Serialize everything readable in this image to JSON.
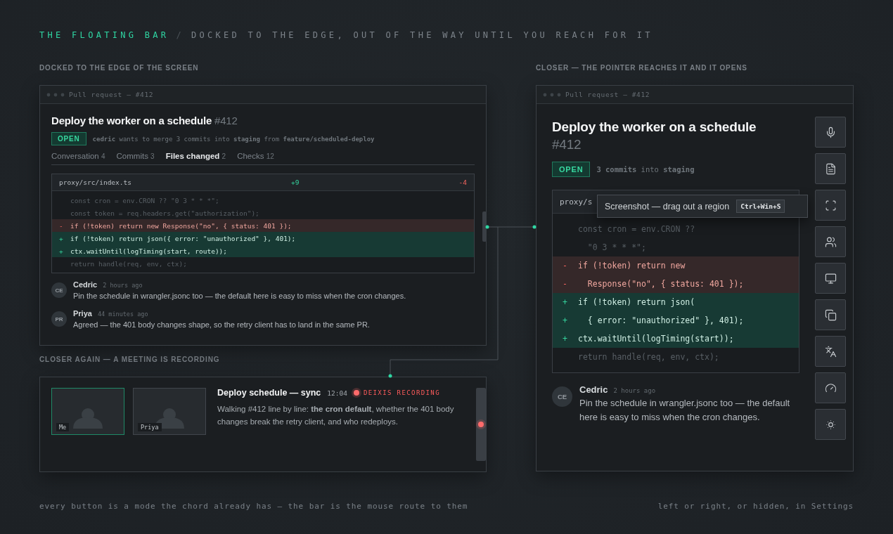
{
  "header": {
    "title": "THE FLOATING BAR",
    "separator": "/",
    "subtitle": "DOCKED TO THE EDGE, OUT OF THE WAY UNTIL YOU REACH FOR IT"
  },
  "docked": {
    "label": "DOCKED TO THE EDGE OF THE SCREEN",
    "window": {
      "titlebar": "Pull request – #412",
      "title": "Deploy the worker on a schedule",
      "number": "#412",
      "status": "OPEN",
      "meta": "**cedric** wants to merge 3 commits into **staging** from **feature/scheduled-deploy**",
      "tabs": [
        {
          "label": "Conversation",
          "count": "4",
          "selected": false
        },
        {
          "label": "Commits",
          "count": "3",
          "selected": false
        },
        {
          "label": "Files changed",
          "count": "2",
          "selected": true
        },
        {
          "label": "Checks",
          "count": "12",
          "selected": false
        }
      ],
      "diff": {
        "file": "proxy/src/index.ts",
        "additions": "+9",
        "deletions": "-4",
        "lines": [
          {
            "kind": "context",
            "code": "const cron = env.CRON ?? \"0 3 * * *\";"
          },
          {
            "kind": "context",
            "code": "const token = req.headers.get(\"authorization\");"
          },
          {
            "kind": "del",
            "sign": "-",
            "code": "if (!token) return new Response(\"no\", { status: 401 });"
          },
          {
            "kind": "add",
            "sign": "+",
            "code": "if (!token) return json({ error: \"unauthorized\" }, 401);"
          },
          {
            "kind": "add",
            "sign": "+",
            "code": "ctx.waitUntil(logTiming(start, route));"
          },
          {
            "kind": "context",
            "code": "return handle(req, env, ctx);"
          }
        ]
      },
      "comments": [
        {
          "initials": "CE",
          "author": "Cedric",
          "time": "2 hours ago",
          "body": "Pin the schedule in wrangler.jsonc too — the default here is easy to miss when the cron changes."
        },
        {
          "initials": "PR",
          "author": "Priya",
          "time": "44 minutes ago",
          "body": "Agreed — the 401 body changes shape, so the retry client has to land in the same PR."
        }
      ]
    }
  },
  "meeting": {
    "label": "CLOSER AGAIN — **A MEETING IS RECORDING**",
    "tiles": [
      {
        "name": "Me",
        "speaking": true
      },
      {
        "name": "Priya",
        "speaking": false
      }
    ],
    "title": "Deploy schedule — sync",
    "time": "12:04",
    "recording": "DEIXIS RECORDING",
    "body": "Walking #412 line by line: **the cron default**, whether the 401 body changes break the retry client, and who redeploys."
  },
  "closer": {
    "label": "CLOSER — **THE POINTER REACHES IT AND IT OPENS**",
    "window": {
      "titlebar": "Pull request – #412",
      "title": "Deploy the worker on a schedule",
      "number": "#412",
      "status": "OPEN",
      "meta": "**3 commits** into **staging**",
      "diff": {
        "file": "proxy/s",
        "lines": [
          {
            "kind": "context",
            "code": "const cron = env.CRON ??"
          },
          {
            "kind": "context",
            "code": "  \"0 3 * * *\";"
          },
          {
            "kind": "del",
            "sign": "-",
            "code": "if (!token) return new"
          },
          {
            "kind": "del",
            "sign": "-",
            "code": "  Response(\"no\", { status: 401 });"
          },
          {
            "kind": "add",
            "sign": "+",
            "code": "if (!token) return json("
          },
          {
            "kind": "add",
            "sign": "+",
            "code": "  { error: \"unauthorized\" }, 401);"
          },
          {
            "kind": "add",
            "sign": "+",
            "code": "ctx.waitUntil(logTiming(start));"
          },
          {
            "kind": "context",
            "code": "return handle(req, env, ctx);"
          }
        ]
      },
      "comments": [
        {
          "initials": "CE",
          "author": "Cedric",
          "time": "2 hours ago",
          "body": "Pin the schedule in wrangler.jsonc too — the default here is easy to miss when the cron changes."
        }
      ]
    },
    "tooltip": {
      "text": "Screenshot — drag out a region",
      "shortcut": "Ctrl+Win+S"
    },
    "toolbar": [
      {
        "kind": "microphone"
      },
      {
        "kind": "notes"
      },
      {
        "kind": "screenshot"
      },
      {
        "kind": "people"
      },
      {
        "kind": "screen"
      },
      {
        "kind": "pages"
      },
      {
        "kind": "translate"
      },
      {
        "kind": "gauge"
      },
      {
        "kind": "brightness"
      }
    ]
  },
  "footer": {
    "left": "every button is a mode the chord already has — the bar is the mouse route to them",
    "right": "left or right, or hidden, in Settings"
  }
}
